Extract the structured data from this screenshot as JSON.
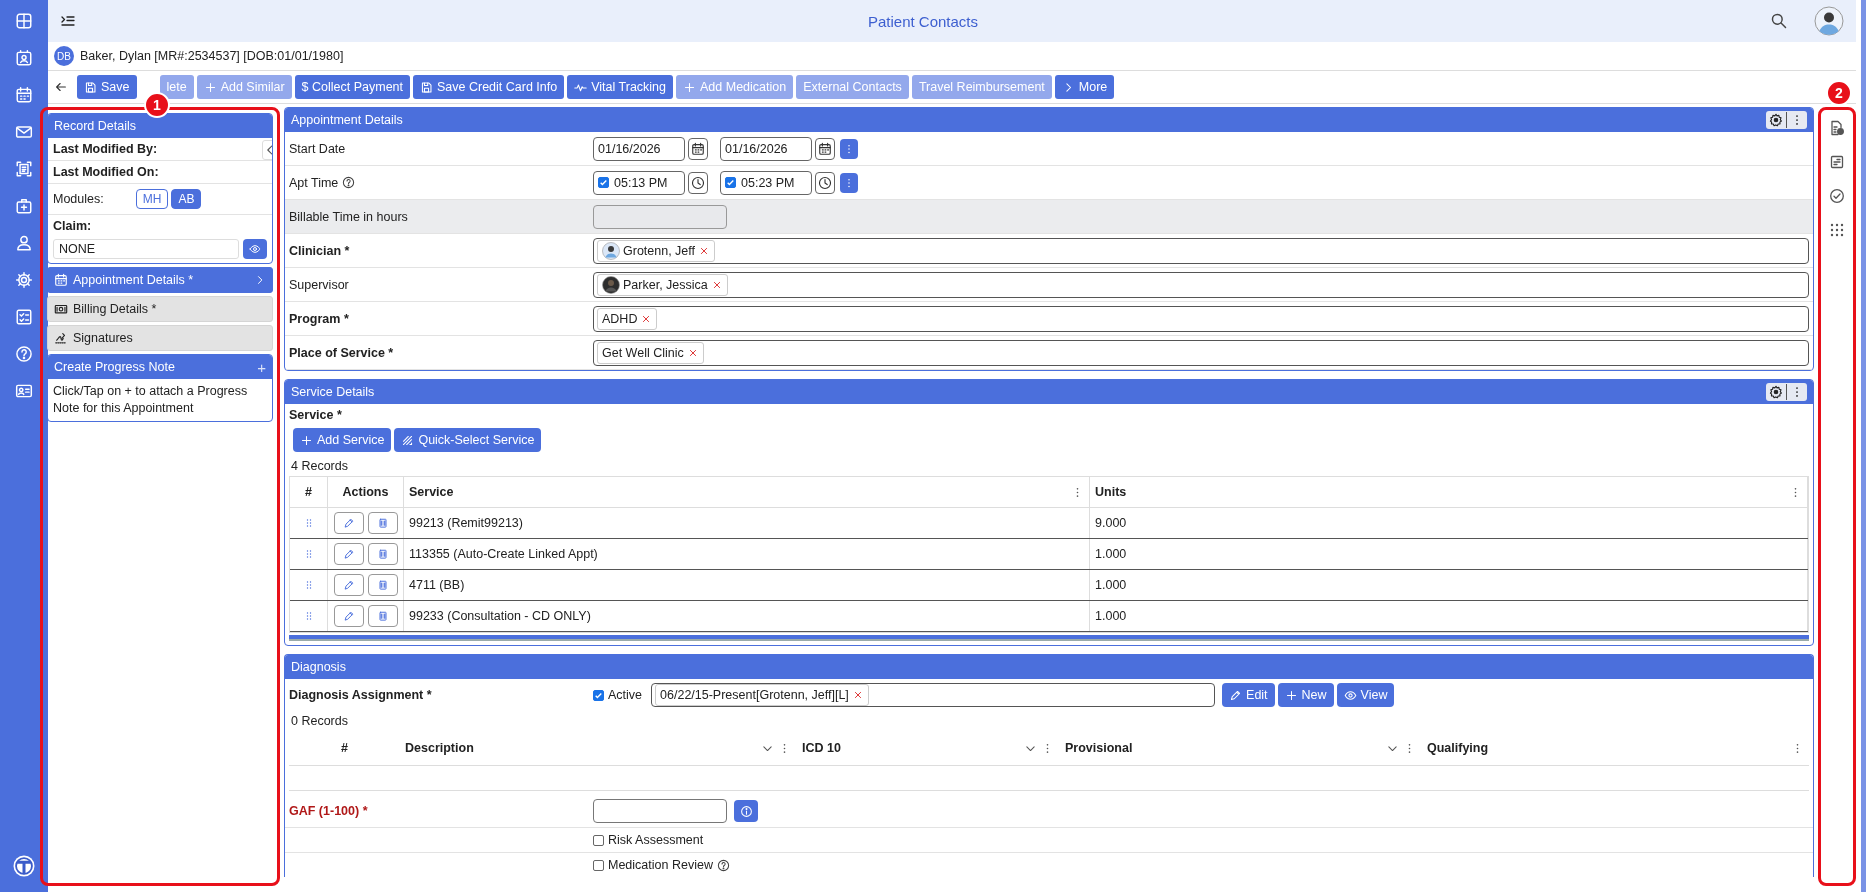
{
  "header": {
    "title": "Patient Contacts"
  },
  "patient": {
    "initials": "DB",
    "summary": "Baker, Dylan [MR#:2534537] [DOB:01/01/1980]"
  },
  "toolbar": [
    {
      "label": "Save",
      "kind": "save",
      "disabled": false
    },
    {
      "label": "lete",
      "kind": "plain",
      "disabled": true
    },
    {
      "label": "Add Similar",
      "kind": "add",
      "disabled": true
    },
    {
      "label": "$ Collect Payment",
      "kind": "plain",
      "disabled": false
    },
    {
      "label": "Save Credit Card Info",
      "kind": "save",
      "disabled": false
    },
    {
      "label": "Vital Tracking",
      "kind": "pulse",
      "disabled": false
    },
    {
      "label": "Add Medication",
      "kind": "add",
      "disabled": true
    },
    {
      "label": "External Contacts",
      "kind": "plain",
      "disabled": true
    },
    {
      "label": "Travel Reimbursement",
      "kind": "plain",
      "disabled": true
    },
    {
      "label": "More",
      "kind": "more",
      "disabled": false
    }
  ],
  "callouts": [
    {
      "label": "1"
    },
    {
      "label": "2"
    }
  ],
  "record_details": {
    "title": "Record Details",
    "fields": [
      {
        "label": "Last Modified By:"
      },
      {
        "label": "Last Modified On:"
      }
    ],
    "modules_label": "Modules:",
    "modules": [
      {
        "label": "MH",
        "selected": false
      },
      {
        "label": "AB",
        "selected": true
      }
    ],
    "claim_label": "Claim:",
    "claim_value": "NONE"
  },
  "sections": [
    {
      "label": "Appointment Details *",
      "kind": "calendar",
      "selected": true
    },
    {
      "label": "Billing Details *",
      "kind": "billing",
      "selected": false
    },
    {
      "label": "Signatures",
      "kind": "signature",
      "selected": false
    }
  ],
  "progress_note": {
    "title": "Create Progress Note",
    "add": "+",
    "text": "Click/Tap on + to attach a Progress Note for this Appointment"
  },
  "appointment": {
    "title": "Appointment Details",
    "rows": [
      {
        "label": "Start Date",
        "kind": "dates",
        "required": false,
        "help": false,
        "values": [
          "01/16/2026",
          "01/16/2026"
        ]
      },
      {
        "label": "Apt Time",
        "kind": "times",
        "required": false,
        "help": true,
        "times": [
          {
            "value": "05:13 PM",
            "checked": true
          },
          {
            "value": "05:23 PM",
            "checked": true
          }
        ]
      },
      {
        "label": "Billable Time in hours",
        "kind": "readonly",
        "required": false,
        "help": false
      },
      {
        "label": "Clinician *",
        "kind": "chips",
        "required": true,
        "help": false,
        "chips": [
          {
            "label": "Grotenn, Jeff",
            "kind": "person"
          }
        ]
      },
      {
        "label": "Supervisor",
        "kind": "chips",
        "required": false,
        "help": false,
        "chips": [
          {
            "label": "Parker, Jessica",
            "kind": "person"
          }
        ]
      },
      {
        "label": "Program *",
        "kind": "chips",
        "required": true,
        "help": false,
        "chips": [
          {
            "label": "ADHD",
            "kind": "text"
          }
        ]
      },
      {
        "label": "Place of Service *",
        "kind": "chips",
        "required": true,
        "help": false,
        "chips": [
          {
            "label": "Get Well Clinic",
            "kind": "text"
          }
        ]
      }
    ]
  },
  "service": {
    "title": "Service Details",
    "label": "Service *",
    "buttons": [
      {
        "label": "Add Service",
        "kind": "add"
      },
      {
        "label": "Quick-Select Service",
        "kind": "quick"
      }
    ],
    "count": "4 Records",
    "columns": [
      {
        "label": "#",
        "kind": "index"
      },
      {
        "label": "Actions",
        "kind": "plain"
      },
      {
        "label": "Service",
        "kind": "menu"
      },
      {
        "label": "Units",
        "kind": "menu"
      }
    ],
    "rows": [
      {
        "service": "99213 (Remit99213)",
        "units": "9.000"
      },
      {
        "service": "113355 (Auto-Create Linked Appt)",
        "units": "1.000"
      },
      {
        "service": "4711 (BB)",
        "units": "1.000"
      },
      {
        "service": "99233 (Consultation - CD ONLY)",
        "units": "1.000"
      }
    ]
  },
  "diagnosis": {
    "title": "Diagnosis",
    "assignment_label": "Diagnosis Assignment *",
    "active": {
      "label": "Active",
      "checked": true
    },
    "assignment": "06/22/15-Present[Grotenn, Jeff][L]",
    "buttons": [
      {
        "label": "Edit",
        "kind": "edit"
      },
      {
        "label": "New",
        "kind": "add"
      },
      {
        "label": "View",
        "kind": "view"
      }
    ],
    "count": "0 Records",
    "columns": [
      {
        "label": "#",
        "kind": "index"
      },
      {
        "label": "Description",
        "kind": "dropdown"
      },
      {
        "label": "ICD 10",
        "kind": "dropdown"
      },
      {
        "label": "Provisional",
        "kind": "dropdown"
      },
      {
        "label": "Qualifying",
        "kind": "menu"
      }
    ],
    "gaf_label": "GAF (1-100) *",
    "options": [
      {
        "label": "Risk Assessment",
        "checked": false,
        "help": false
      },
      {
        "label": "Medication Review",
        "checked": false,
        "help": true
      }
    ]
  }
}
